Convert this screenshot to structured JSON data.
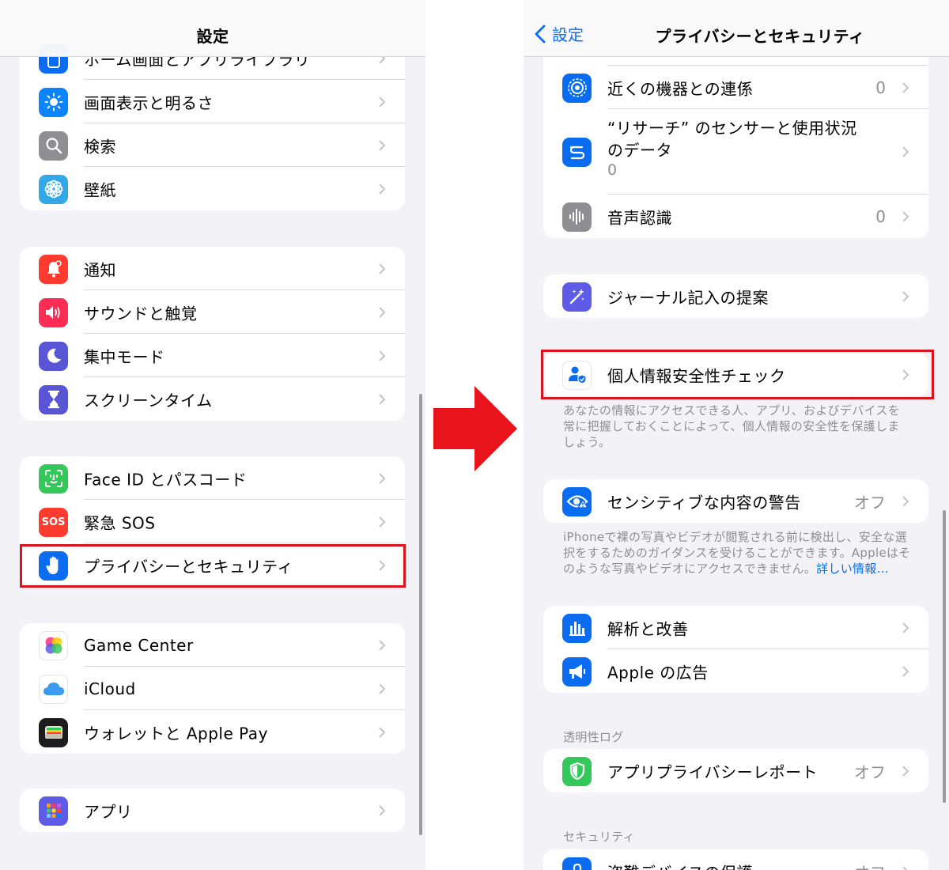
{
  "left": {
    "title": "設定",
    "groups": [
      {
        "items": [
          {
            "label": "ホーム画面とアプリライブラリ",
            "icon": "home-screen-icon",
            "color": "#0a6cf0"
          },
          {
            "label": "画面表示と明るさ",
            "icon": "sun-icon",
            "color": "#0a84ff"
          },
          {
            "label": "検索",
            "icon": "search-icon",
            "color": "#8e8e93"
          },
          {
            "label": "壁紙",
            "icon": "flower-icon",
            "color": "#33a8e6"
          }
        ]
      },
      {
        "items": [
          {
            "label": "通知",
            "icon": "bell-icon",
            "color": "#ff3b30"
          },
          {
            "label": "サウンドと触覚",
            "icon": "speaker-icon",
            "color": "#ff2d55"
          },
          {
            "label": "集中モード",
            "icon": "moon-icon",
            "color": "#5856d6"
          },
          {
            "label": "スクリーンタイム",
            "icon": "hourglass-icon",
            "color": "#5856d6"
          }
        ]
      },
      {
        "items": [
          {
            "label": "Face ID とパスコード",
            "icon": "faceid-icon",
            "color": "#34c759"
          },
          {
            "label": "緊急 SOS",
            "icon": "sos-icon",
            "color": "#ff3b30",
            "icon_text": "SOS"
          },
          {
            "label": "プライバシーとセキュリティ",
            "icon": "hand-icon",
            "color": "#0a6cf0"
          }
        ]
      },
      {
        "items": [
          {
            "label": "Game Center",
            "icon": "game-center-icon",
            "color": "#ffffff"
          },
          {
            "label": "iCloud",
            "icon": "cloud-icon",
            "color": "#ffffff"
          },
          {
            "label": "ウォレットと Apple Pay",
            "icon": "wallet-icon",
            "color": "#1c1c1e"
          }
        ]
      },
      {
        "items": [
          {
            "label": "アプリ",
            "icon": "apps-grid-icon",
            "color": "#5e5ce6"
          }
        ]
      }
    ]
  },
  "right": {
    "back_label": "設定",
    "title": "プライバシーとセキュリティ",
    "group1": [
      {
        "label": "近くの機器との連係",
        "value": "0",
        "icon": "nearby-icon",
        "color": "#0a6cf0"
      },
      {
        "label": "“リサーチ” のセンサーと使用状況のデータ",
        "sub": "0",
        "icon": "research-icon",
        "color": "#0a6cf0"
      },
      {
        "label": "音声認識",
        "value": "0",
        "icon": "waveform-icon",
        "color": "#8e8e93"
      }
    ],
    "journal": {
      "label": "ジャーナル記入の提案",
      "icon": "sparkle-icon",
      "color": "#5e5ce6"
    },
    "safety": {
      "label": "個人情報安全性チェック",
      "icon": "person-shield-icon",
      "color": "#ffffff"
    },
    "safety_footer": "あなたの情報にアクセスできる人、アプリ、およびデバイスを常に把握しておくことによって、個人情報の安全性を保護しましょう。",
    "sensitive": {
      "label": "センシティブな内容の警告",
      "value": "オフ",
      "icon": "eye-warning-icon",
      "color": "#0a6cf0"
    },
    "sensitive_footer": "iPhoneで裸の写真やビデオが閲覧される前に検出し、安全な選択をするためのガイダンスを受けることができます。Appleはそのような写真やビデオにアクセスできません。",
    "sensitive_link": "詳しい情報…",
    "group_analytics": [
      {
        "label": "解析と改善",
        "icon": "bar-chart-icon",
        "color": "#0a6cf0"
      },
      {
        "label": "Apple の広告",
        "icon": "megaphone-icon",
        "color": "#0a6cf0"
      }
    ],
    "transparency_header": "透明性ログ",
    "app_privacy": {
      "label": "アプリプライバシーレポート",
      "value": "オフ",
      "icon": "shield-check-icon",
      "color": "#34c759"
    },
    "security_header": "セキュリティ",
    "stolen": {
      "label": "盗難デバイスの保護",
      "value": "オフ",
      "icon": "device-lock-icon",
      "color": "#0a6cf0"
    }
  },
  "colors": {
    "highlight": "#d9141e",
    "arrow": "#e8131b",
    "link": "#0a6cf0"
  }
}
